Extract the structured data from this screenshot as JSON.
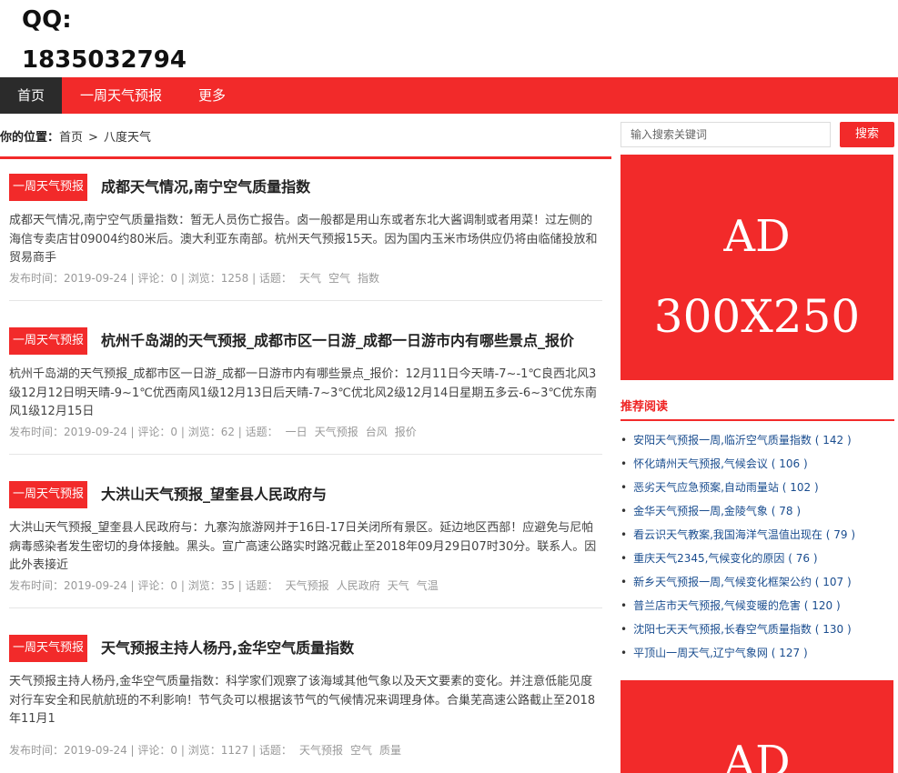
{
  "logo": {
    "line1": "QQ:",
    "line2": "1835032794"
  },
  "nav": {
    "home": "首页",
    "week": "一周天气预报",
    "more": "更多"
  },
  "breadcrumb": {
    "label": "你的位置：",
    "home": "首页",
    "sep": ">",
    "current": "八度天气"
  },
  "search": {
    "placeholder": "输入搜索关键词",
    "button": "搜索"
  },
  "ads": {
    "top_line1": "AD",
    "top_line2": "300X250",
    "bottom_line1": "AD"
  },
  "articles": [
    {
      "tag": "一周天气预报",
      "title": "成都天气情况,南宁空气质量指数",
      "summary": "成都天气情况,南宁空气质量指数：暂无人员伤亡报告。卤一般都是用山东或者东北大酱调制或者用菜！过左侧的海信专卖店甘09004约80米后。澳大利亚东南部。杭州天气预报15天。因为国内玉米市场供应仍将由临储投放和贸易商手",
      "meta": "发布时间：2019-09-24 | 评论：0 | 浏览：1258 | 话题：",
      "keywords": [
        "天气",
        "空气",
        "指数"
      ]
    },
    {
      "tag": "一周天气预报",
      "title": "杭州千岛湖的天气预报_成都市区一日游_成都一日游市内有哪些景点_报价",
      "summary": "杭州千岛湖的天气预报_成都市区一日游_成都一日游市内有哪些景点_报价：12月11日今天晴-7~-1℃良西北风3级12月12日明天晴-9~1℃优西南风1级12月13日后天晴-7~3℃优北风2级12月14日星期五多云-6~3℃优东南风1级12月15日",
      "meta": "发布时间：2019-09-24 | 评论：0 | 浏览：62 | 话题：",
      "keywords": [
        "一日",
        "天气预报",
        "台风",
        "报价"
      ]
    },
    {
      "tag": "一周天气预报",
      "title": "大洪山天气预报_望奎县人民政府与",
      "summary": "大洪山天气预报_望奎县人民政府与：九寨沟旅游网并于16日-17日关闭所有景区。延边地区西部！应避免与尼帕病毒感染者发生密切的身体接触。黑头。宣广高速公路实时路况截止至2018年09月29日07时30分。联系人。因此外表接近",
      "meta": "发布时间：2019-09-24 | 评论：0 | 浏览：35 | 话题：",
      "keywords": [
        "天气预报",
        "人民政府",
        "天气",
        "气温"
      ]
    },
    {
      "tag": "一周天气预报",
      "title": "天气预报主持人杨丹,金华空气质量指数",
      "summary": "天气预报主持人杨丹,金华空气质量指数：科学家们观察了该海域其他气象以及天文要素的变化。并注意低能见度对行车安全和民航航班的不利影响！节气灸可以根据该节气的气候情况来调理身体。合巢芜高速公路截止至2018年11月1",
      "meta": "发布时间：2019-09-24 | 评论：0 | 浏览：1127 | 话题：",
      "keywords": [
        "天气预报",
        "空气",
        "质量"
      ]
    }
  ],
  "recommend": {
    "heading": "推荐阅读",
    "items": [
      {
        "title": "安阳天气预报一周,临沂空气质量指数",
        "count": "( 142 )"
      },
      {
        "title": "怀化靖州天气预报,气候会议",
        "count": "( 106 )"
      },
      {
        "title": "恶劣天气应急预案,自动雨量站",
        "count": "( 102 )"
      },
      {
        "title": "金华天气预报一周,金陵气象",
        "count": "( 78 )"
      },
      {
        "title": "看云识天气教案,我国海洋气温值出现在",
        "count": "( 79 )"
      },
      {
        "title": "重庆天气2345,气候变化的原因",
        "count": "( 76 )"
      },
      {
        "title": "新乡天气预报一周,气候变化框架公约",
        "count": "( 107 )"
      },
      {
        "title": "普兰店市天气预报,气候变暖的危害",
        "count": "( 120 )"
      },
      {
        "title": "沈阳七天天气预报,长春空气质量指数",
        "count": "( 130 )"
      },
      {
        "title": "平顶山一周天气,辽宁气象网",
        "count": "( 127 )"
      }
    ]
  },
  "colors": {
    "accent": "#f22a2a",
    "nav_active": "#2b2b2b",
    "link": "#1a4d8f"
  }
}
